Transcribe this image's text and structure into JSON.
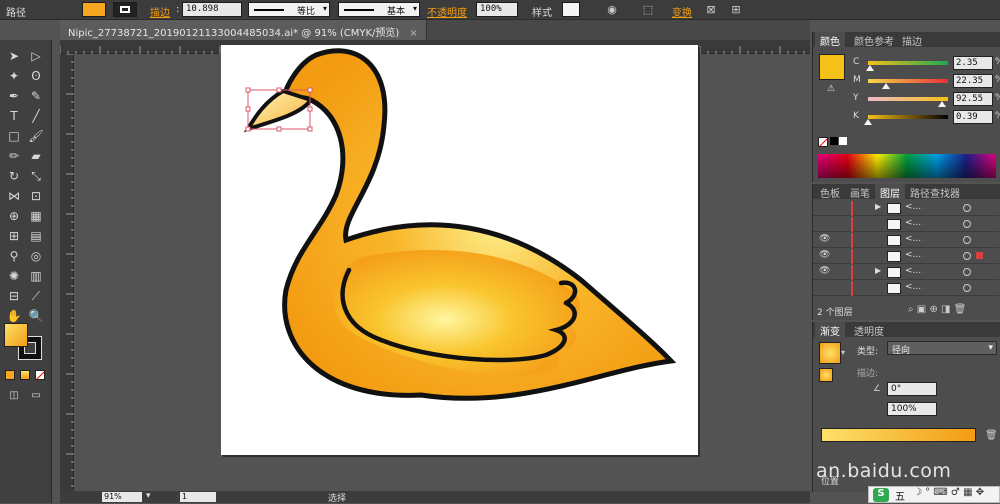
{
  "control": {
    "mode_label": "路径",
    "stroke_label": "描边",
    "stroke_value": "10.898",
    "profile_label": "等比",
    "brush_label": "基本",
    "opacity_label": "不透明度",
    "opacity_value": "100%",
    "style_label": "样式",
    "transform_label": "变换"
  },
  "tab": {
    "title": "Nipic_27738721_20190121133004485034.ai* @ 91% (CMYK/预览)",
    "close": "×"
  },
  "color_panel": {
    "tabs": [
      "颜色",
      "颜色参考",
      "描边"
    ],
    "channels": [
      {
        "key": "C",
        "value": "2.35",
        "fraction": 0.0235
      },
      {
        "key": "M",
        "value": "22.35",
        "fraction": 0.2235
      },
      {
        "key": "Y",
        "value": "92.55",
        "fraction": 0.9255
      },
      {
        "key": "K",
        "value": "0.39",
        "fraction": 0.0039
      }
    ],
    "pct": "%",
    "fill_color": "#F5C018"
  },
  "layers_panel": {
    "tabs": [
      "色板",
      "画笔",
      "图层",
      "路径查找器"
    ],
    "rows": [
      {
        "name": "<..."
      },
      {
        "name": "<..."
      },
      {
        "name": "<..."
      },
      {
        "name": "<..."
      },
      {
        "name": "<..."
      },
      {
        "name": "<..."
      }
    ],
    "footer": "2 个图层"
  },
  "gradient_panel": {
    "tabs": [
      "渐变",
      "透明度"
    ],
    "type_label": "类型:",
    "type_value": "径向",
    "stroke_label": "描边:",
    "angle_value": "0°",
    "ratio_value": "100%",
    "location_label": "位置"
  },
  "status": {
    "zoom": "91%",
    "page": "1",
    "mode": "选择"
  },
  "watermark": {
    "text": "an.baidu.com"
  },
  "taskbar": {
    "ime": "五"
  },
  "colors": {
    "accent": "#F39C12",
    "swan_body": "#F7A81B",
    "swan_light": "#FDEB7A"
  }
}
